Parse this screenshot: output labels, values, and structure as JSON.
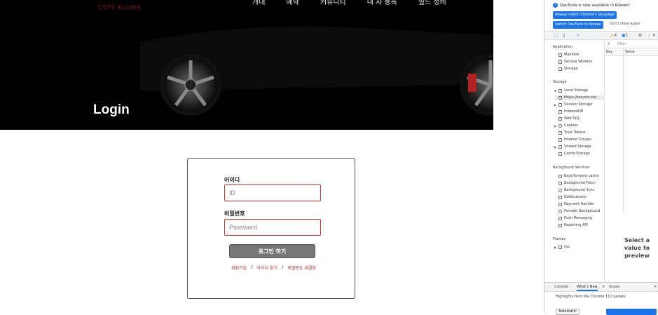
{
  "hero": {
    "logo_text": "CSTS KLUSIK",
    "nav": [
      "개대",
      "예약",
      "커뮤니티",
      "내 자 동록",
      "일드 정비"
    ],
    "title": "Login"
  },
  "login": {
    "id_label": "아이디",
    "id_placeholder": "ID",
    "pw_label": "비밀번호",
    "pw_placeholder": "Password",
    "submit": "로그인 하기",
    "links": [
      "회원가입",
      "아이디 찾기",
      "비밀번호 재설정"
    ],
    "sep": "/"
  },
  "devtools": {
    "info_msg": "DevTools is now available in Korean!",
    "btn_match": "Always match Chrome's language",
    "btn_switch": "Switch DevTools to Korean",
    "dont_show": "Don't show again",
    "warn_count": "4",
    "msg_count": "1",
    "tab_more": "»",
    "sections": {
      "application": "Application",
      "storage": "Storage",
      "background": "Background Services",
      "frames": "Frames"
    },
    "app_items": [
      "Manifest",
      "Service Workers",
      "Storage"
    ],
    "storage_items": [
      "Local Storage",
      "https://zxcvsm.sto",
      "Session Storage",
      "IndexedDB",
      "Web SQL",
      "Cookies",
      "Trust Tokens",
      "Interest Groups",
      "Shared Storage",
      "Cache Storage"
    ],
    "bg_items": [
      "Back/forward cache",
      "Background Fetch",
      "Background Sync",
      "Notifications",
      "Payment Handler",
      "Periodic Background",
      "Push Messaging",
      "Reporting API"
    ],
    "frame_item": "top",
    "filter": "Filter",
    "col_key": "Key",
    "col_value": "Value",
    "preview": "Select a value to preview",
    "drawer_tabs": [
      "Console",
      "What's New",
      "Issues"
    ],
    "highlights": "Highlights from the Chrome 111 update",
    "drawer_btn": "Automatic"
  }
}
